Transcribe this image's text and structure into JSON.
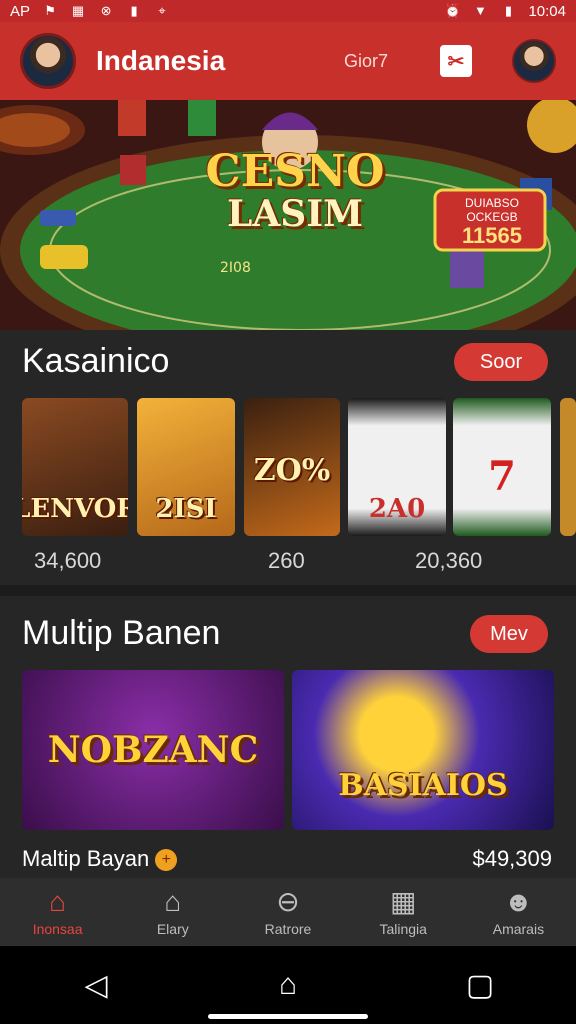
{
  "status_bar": {
    "left_text": "AP",
    "time": "10:04",
    "icons": [
      "location-icon",
      "notification-icon",
      "close-circle-icon",
      "battery-icon",
      "map-pin-icon",
      "alarm-icon",
      "wifi-icon",
      "battery-icon"
    ]
  },
  "header": {
    "title": "Indanesia",
    "subtitle": "Gior7",
    "promo_icon": "ticket-icon"
  },
  "hero": {
    "logo_line1": "CESNO",
    "logo_line2": "LASIM",
    "badge_line1": "DUIABSO",
    "badge_line2": "OCKEGB",
    "badge_value": "11565",
    "table_text": "2I08"
  },
  "section1": {
    "title": "Kasainico",
    "pill": "Soor",
    "tiles": [
      {
        "label": "LENVOR",
        "color": "#6b3a1c"
      },
      {
        "label": "2ISI",
        "color": "#d98a1e"
      },
      {
        "label": "ZO%",
        "color": "#8a4a14"
      },
      {
        "label": "2A0",
        "color": "#f2f2f2"
      },
      {
        "label": "7",
        "color": "#2e7a2e"
      }
    ],
    "counts": [
      "34,600",
      "260",
      "20,360"
    ]
  },
  "section2": {
    "title": "Multip Banen",
    "pill": "Mev",
    "banners": [
      {
        "label": "NOBZANC",
        "color": "#5a1e6e"
      },
      {
        "label": "BASIAIOS",
        "color": "#2a1f6a"
      }
    ],
    "footer_left": "Maltip Bayan",
    "footer_right": "$49,309"
  },
  "bottom_nav": [
    {
      "label": "Inonsaa",
      "icon": "home-icon",
      "active": true
    },
    {
      "label": "Elary",
      "icon": "shop-icon",
      "active": false
    },
    {
      "label": "Ratrore",
      "icon": "search-icon",
      "active": false
    },
    {
      "label": "Talingia",
      "icon": "grid-icon",
      "active": false
    },
    {
      "label": "Amarais",
      "icon": "profile-icon",
      "active": false
    }
  ],
  "system_nav": [
    "back-icon",
    "home-circle-icon",
    "recent-apps-icon"
  ]
}
